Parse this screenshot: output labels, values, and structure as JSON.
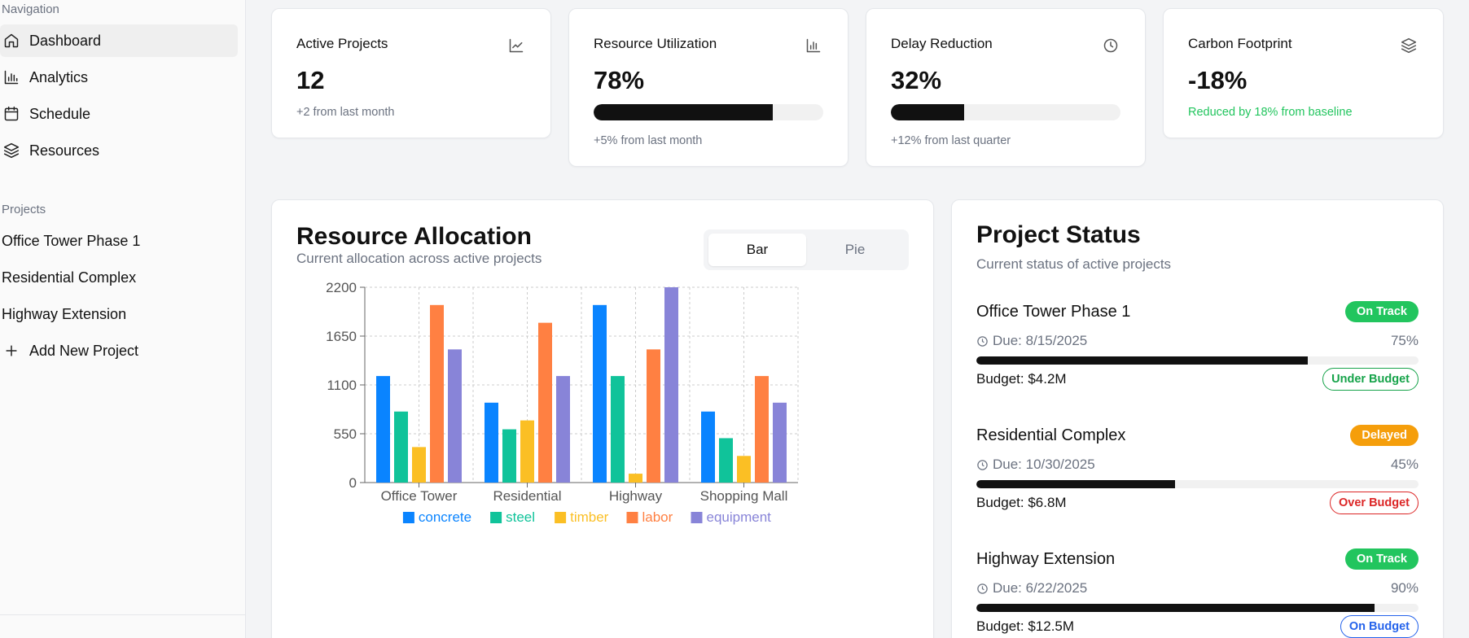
{
  "sidebar": {
    "nav_heading": "Navigation",
    "nav": [
      {
        "label": "Dashboard",
        "icon": "home-icon",
        "active": true
      },
      {
        "label": "Analytics",
        "icon": "bar-chart-icon",
        "active": false
      },
      {
        "label": "Schedule",
        "icon": "calendar-icon",
        "active": false
      },
      {
        "label": "Resources",
        "icon": "layers-icon",
        "active": false
      }
    ],
    "projects_heading": "Projects",
    "projects": [
      "Office Tower Phase 1",
      "Residential Complex",
      "Highway Extension"
    ],
    "add_project": "Add New Project"
  },
  "stats": [
    {
      "title": "Active Projects",
      "value": "12",
      "sub": "+2 from last month",
      "icon": "trend-icon"
    },
    {
      "title": "Resource Utilization",
      "value": "78%",
      "sub": "+5% from last month",
      "progress": 0.78,
      "icon": "bar-chart-icon"
    },
    {
      "title": "Delay Reduction",
      "value": "32%",
      "sub": "+12% from last quarter",
      "progress": 0.32,
      "icon": "clock-icon"
    },
    {
      "title": "Carbon Footprint",
      "value": "-18%",
      "sub": "Reduced by 18% from baseline",
      "sub_color": "#22c55e",
      "icon": "layers-icon"
    }
  ],
  "allocation": {
    "title": "Resource Allocation",
    "subtitle": "Current allocation across active projects",
    "toggle": {
      "bar": "Bar",
      "pie": "Pie",
      "selected": "Bar"
    }
  },
  "chart_data": {
    "type": "bar",
    "categories": [
      "Office Tower",
      "Residential",
      "Highway",
      "Shopping Mall"
    ],
    "series": [
      {
        "name": "concrete",
        "color": "#0a84ff",
        "values": [
          1200,
          900,
          2000,
          800
        ]
      },
      {
        "name": "steel",
        "color": "#10c39a",
        "values": [
          800,
          600,
          1200,
          500
        ]
      },
      {
        "name": "timber",
        "color": "#fbbf24",
        "values": [
          400,
          700,
          100,
          300
        ]
      },
      {
        "name": "labor",
        "color": "#ff8042",
        "values": [
          2000,
          1800,
          1500,
          1200
        ]
      },
      {
        "name": "equipment",
        "color": "#8884d8",
        "values": [
          1500,
          1200,
          2200,
          900
        ]
      }
    ],
    "yticks": [
      0,
      550,
      1100,
      1650,
      2200
    ],
    "ylim": [
      0,
      2200
    ],
    "grid": true,
    "legend": "bottom"
  },
  "status": {
    "title": "Project Status",
    "subtitle": "Current status of active projects",
    "projects": [
      {
        "name": "Office Tower Phase 1",
        "status": "On Track",
        "status_color": "#22c55e",
        "due": "Due: 8/15/2025",
        "percent": "75%",
        "progress": 0.75,
        "budget": "Budget: $4.2M",
        "budget_status": "Under Budget",
        "budget_color": "#16a34a"
      },
      {
        "name": "Residential Complex",
        "status": "Delayed",
        "status_color": "#f59e0b",
        "due": "Due: 10/30/2025",
        "percent": "45%",
        "progress": 0.45,
        "budget": "Budget: $6.8M",
        "budget_status": "Over Budget",
        "budget_color": "#dc2626"
      },
      {
        "name": "Highway Extension",
        "status": "On Track",
        "status_color": "#22c55e",
        "due": "Due: 6/22/2025",
        "percent": "90%",
        "progress": 0.9,
        "budget": "Budget: $12.5M",
        "budget_status": "On Budget",
        "budget_color": "#2563eb"
      }
    ]
  }
}
